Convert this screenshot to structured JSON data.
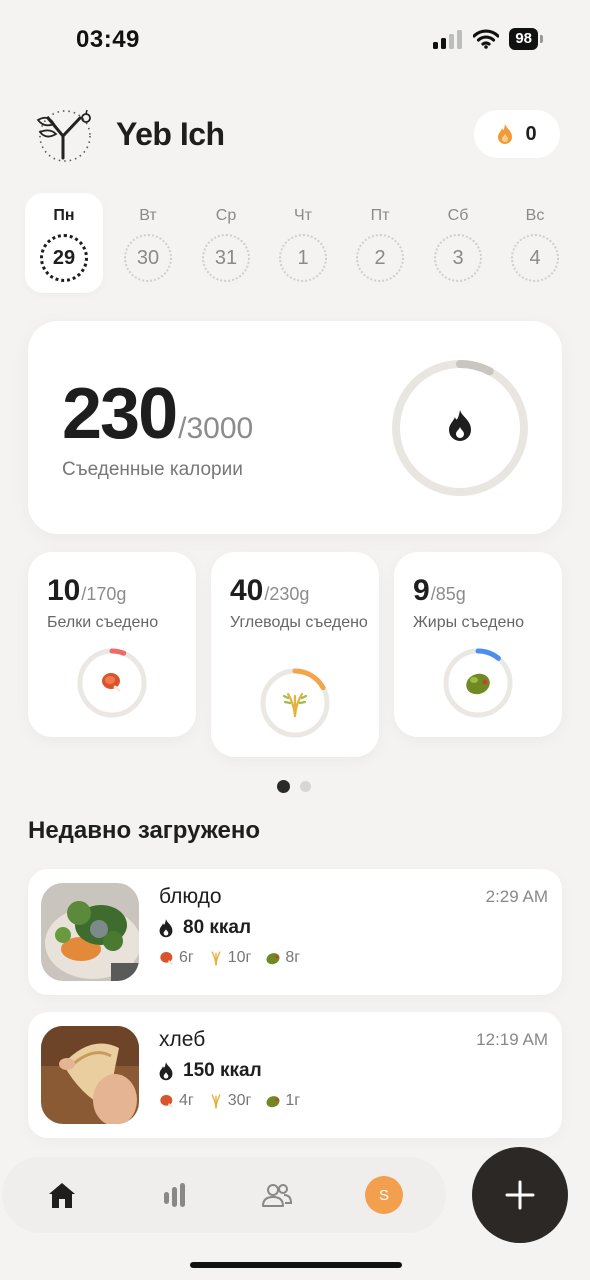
{
  "status_bar": {
    "time": "03:49",
    "battery": "98"
  },
  "header": {
    "app_title": "Yeb Ich",
    "streak_count": "0"
  },
  "week": [
    {
      "name": "Пн",
      "date": "29",
      "selected": true
    },
    {
      "name": "Вт",
      "date": "30",
      "selected": false
    },
    {
      "name": "Ср",
      "date": "31",
      "selected": false
    },
    {
      "name": "Чт",
      "date": "1",
      "selected": false
    },
    {
      "name": "Пт",
      "date": "2",
      "selected": false
    },
    {
      "name": "Сб",
      "date": "3",
      "selected": false
    },
    {
      "name": "Вс",
      "date": "4",
      "selected": false
    }
  ],
  "calories": {
    "eaten": "230",
    "goal": "/3000",
    "label": "Съеденные калории",
    "progress_fraction": 0.077
  },
  "macros": [
    {
      "value": "10",
      "goal": "/170g",
      "label": "Белки съедено",
      "progress_fraction": 0.06,
      "color": "#ef6b6b",
      "icon": "meat-icon"
    },
    {
      "value": "40",
      "goal": "/230g",
      "label": "Углеводы съедено",
      "progress_fraction": 0.17,
      "color": "#f2a54a",
      "icon": "wheat-icon"
    },
    {
      "value": "9",
      "goal": "/85g",
      "label": "Жиры съедено",
      "progress_fraction": 0.11,
      "color": "#4b8ef0",
      "icon": "olive-icon"
    }
  ],
  "pager": {
    "pages": 2,
    "active": 0
  },
  "recent": {
    "title": "Недавно загружено",
    "items": [
      {
        "name": "блюдо",
        "time": "2:29 AM",
        "kcal": "80 ккал",
        "protein": "6г",
        "carbs": "10г",
        "fat": "8г"
      },
      {
        "name": "хлеб",
        "time": "12:19 AM",
        "kcal": "150 ккал",
        "protein": "4г",
        "carbs": "30г",
        "fat": "1г"
      }
    ]
  },
  "tab_bar": {
    "avatar_initial": "S",
    "icons": [
      "home-icon",
      "stats-icon",
      "people-icon",
      "avatar"
    ]
  },
  "colors": {
    "accent_orange": "#f2a04e",
    "dark": "#2b2826",
    "background": "#f4f3f1"
  }
}
